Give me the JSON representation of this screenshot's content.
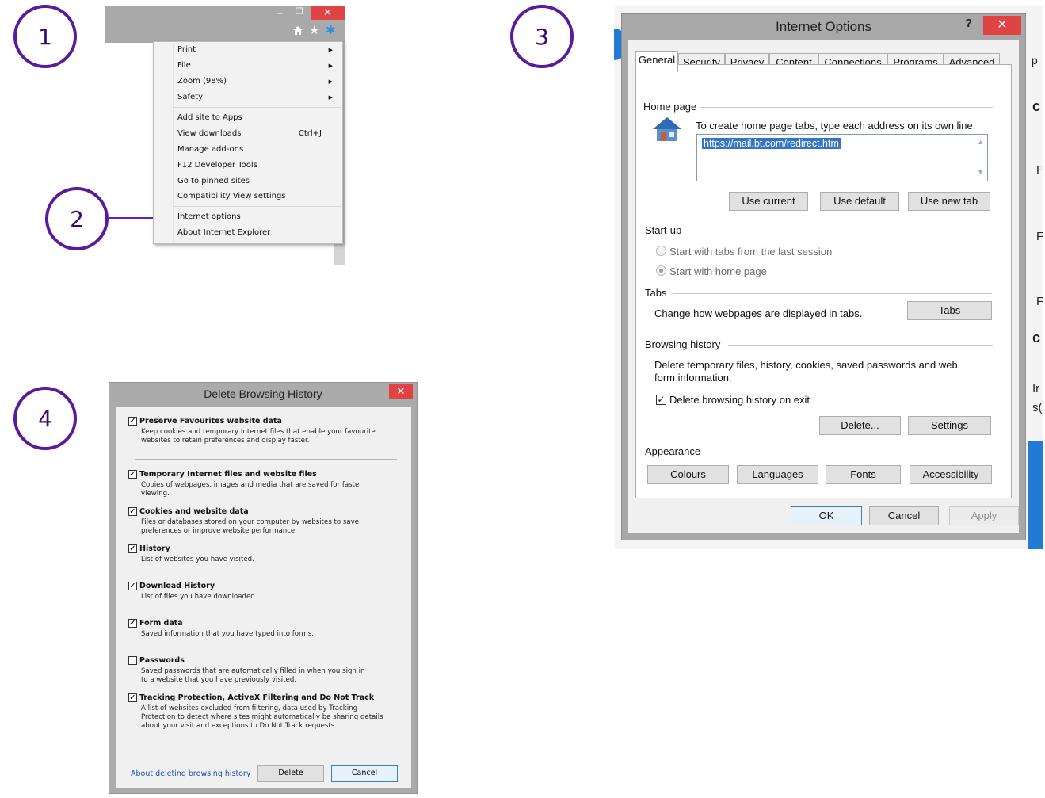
{
  "steps": [
    "1",
    "2",
    "3",
    "4"
  ],
  "ie_window": {
    "minimize": "–",
    "restore": "❐",
    "close": "✕",
    "toolbar_icons": [
      "home-icon",
      "star-icon",
      "gear-icon"
    ]
  },
  "tools_menu": {
    "items": [
      {
        "label": "Print",
        "submenu": true
      },
      {
        "label": "File",
        "submenu": true
      },
      {
        "label": "Zoom (98%)",
        "submenu": true
      },
      {
        "label": "Safety",
        "submenu": true
      },
      {
        "label": "Add site to Apps"
      },
      {
        "label": "View downloads",
        "shortcut": "Ctrl+J"
      },
      {
        "label": "Manage add-ons"
      },
      {
        "label": "F12 Developer Tools"
      },
      {
        "label": "Go to pinned sites"
      },
      {
        "label": "Compatibility View settings"
      },
      {
        "label": "Internet options"
      },
      {
        "label": "About Internet Explorer"
      }
    ],
    "arrow": "▶"
  },
  "internet_options": {
    "title": "Internet Options",
    "help": "?",
    "close": "✕",
    "tabs": [
      "General",
      "Security",
      "Privacy",
      "Content",
      "Connections",
      "Programs",
      "Advanced"
    ],
    "active_tab": "General",
    "home_page": {
      "heading": "Home page",
      "instruction": "To create home page tabs, type each address on its own line.",
      "url": "https://mail.bt.com/redirect.htm",
      "buttons": [
        "Use current",
        "Use default",
        "Use new tab"
      ]
    },
    "startup": {
      "heading": "Start-up",
      "options": [
        "Start with tabs from the last session",
        "Start with home page"
      ],
      "selected": "Start with home page"
    },
    "tabs_section": {
      "heading": "Tabs",
      "text": "Change how webpages are displayed in tabs.",
      "button": "Tabs"
    },
    "browsing_history": {
      "heading": "Browsing history",
      "text_line1": "Delete temporary files, history, cookies, saved passwords and web",
      "text_line2": "form information.",
      "checkbox_label": "Delete browsing history on exit",
      "checked": true,
      "buttons": [
        "Delete...",
        "Settings"
      ]
    },
    "appearance": {
      "heading": "Appearance",
      "buttons": [
        "Colours",
        "Languages",
        "Fonts",
        "Accessibility"
      ]
    },
    "footer_buttons": [
      "OK",
      "Cancel",
      "Apply"
    ]
  },
  "background_letters": [
    "p",
    "c",
    "F",
    "F",
    "F",
    "c",
    "Ir",
    "s("
  ],
  "delete_history": {
    "title": "Delete Browsing History",
    "close": "✕",
    "items": [
      {
        "title": "Preserve Favourites website data",
        "checked": true,
        "desc": [
          "Keep cookies and temporary Internet files that enable your favourite",
          "websites to retain preferences and display faster."
        ]
      },
      {
        "title": "Temporary Internet files and website files",
        "checked": true,
        "desc": [
          "Copies of webpages, images and media that are saved for faster",
          "viewing."
        ]
      },
      {
        "title": "Cookies and website data",
        "checked": true,
        "desc": [
          "Files or databases stored on your computer by websites to save",
          "preferences or improve website performance."
        ]
      },
      {
        "title": "History",
        "checked": true,
        "desc": [
          "List of websites you have visited."
        ]
      },
      {
        "title": "Download History",
        "checked": true,
        "desc": [
          "List of files you have downloaded."
        ]
      },
      {
        "title": "Form data",
        "checked": true,
        "desc": [
          "Saved information that you have typed into forms."
        ]
      },
      {
        "title": "Passwords",
        "checked": false,
        "desc": [
          "Saved passwords that are automatically filled in when you sign in",
          "to a website that you have previously visited."
        ]
      },
      {
        "title": "Tracking Protection, ActiveX Filtering and Do Not Track",
        "checked": true,
        "desc": [
          "A list of websites excluded from filtering, data used by Tracking",
          "Protection to detect where sites might automatically be sharing details",
          "about your visit and exceptions to Do Not Track requests."
        ]
      }
    ],
    "link": "About deleting browsing history",
    "buttons": [
      "Delete",
      "Cancel"
    ]
  },
  "colors": {
    "step_ring": "#5a1a9a",
    "arrow": "#6a1fb0",
    "close_red": "#e04343",
    "url_highlight": "#3374c5",
    "bg_blue": "#1f7bd6"
  }
}
